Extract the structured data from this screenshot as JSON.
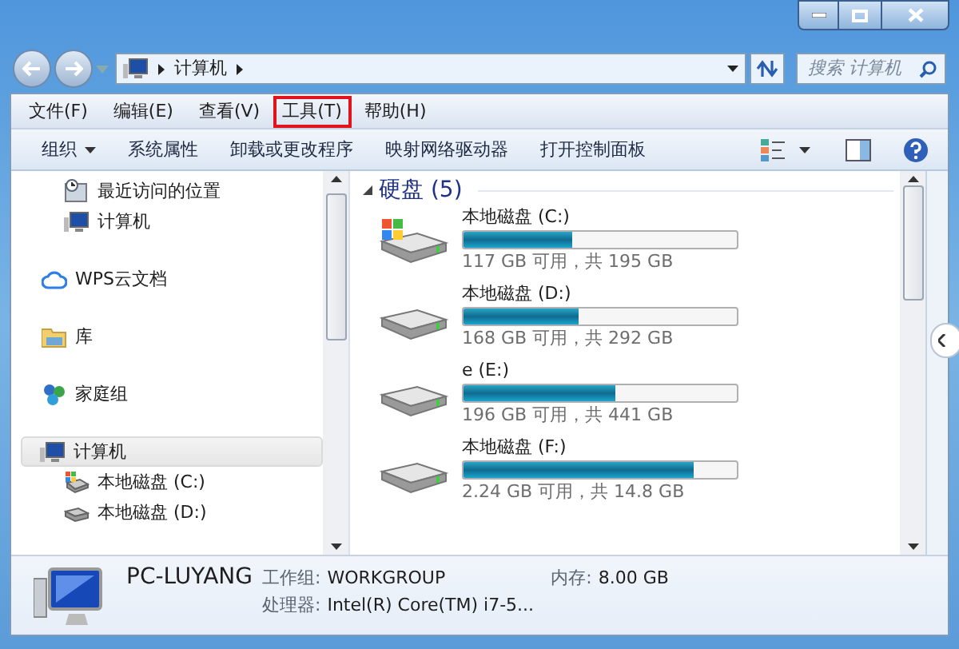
{
  "address_bar": {
    "path": [
      "计算机"
    ],
    "search_placeholder": "搜索 计算机"
  },
  "menu": [
    {
      "label": "文件(F)",
      "highlighted": false
    },
    {
      "label": "编辑(E)",
      "highlighted": false
    },
    {
      "label": "查看(V)",
      "highlighted": false
    },
    {
      "label": "工具(T)",
      "highlighted": true
    },
    {
      "label": "帮助(H)",
      "highlighted": false
    }
  ],
  "toolbar": [
    {
      "label": "组织",
      "dropdown": true
    },
    {
      "label": "系统属性",
      "dropdown": false
    },
    {
      "label": "卸载或更改程序",
      "dropdown": false
    },
    {
      "label": "映射网络驱动器",
      "dropdown": false
    },
    {
      "label": "打开控制面板",
      "dropdown": false
    }
  ],
  "nav": [
    {
      "kind": "recent",
      "label": "最近访问的位置",
      "selected": false
    },
    {
      "kind": "computer",
      "label": "计算机",
      "selected": false
    },
    {
      "kind": "cloud",
      "label": "WPS云文档",
      "selected": false
    },
    {
      "kind": "library",
      "label": "库",
      "selected": false
    },
    {
      "kind": "homegroup",
      "label": "家庭组",
      "selected": false
    },
    {
      "kind": "computer",
      "label": "计算机",
      "selected": true,
      "children": [
        {
          "kind": "windisk",
          "label": "本地磁盘 (C:)",
          "selected": false
        },
        {
          "kind": "disk",
          "label": "本地磁盘 (D:)",
          "selected": false
        }
      ]
    }
  ],
  "group": {
    "title": "硬盘 (5)"
  },
  "drives": [
    {
      "kind": "system",
      "name": "本地磁盘 (C:)",
      "level": 0.4,
      "space": "117 GB 可用，共 195 GB"
    },
    {
      "kind": "data",
      "name": "本地磁盘 (D:)",
      "level": 0.42,
      "space": "168 GB 可用，共 292 GB"
    },
    {
      "kind": "data",
      "name": "e (E:)",
      "level": 0.555,
      "space": "196 GB 可用，共 441 GB"
    },
    {
      "kind": "data",
      "name": "本地磁盘 (F:)",
      "level": 0.84,
      "space": "2.24 GB 可用，共 14.8 GB"
    }
  ],
  "details": {
    "name": "PC-LUYANG",
    "workgroup_label": "工作组:",
    "workgroup": "WORKGROUP",
    "memory_label": "内存:",
    "memory": "8.00 GB",
    "cpu_label": "处理器:",
    "cpu": "Intel(R) Core(TM) i7-5..."
  }
}
